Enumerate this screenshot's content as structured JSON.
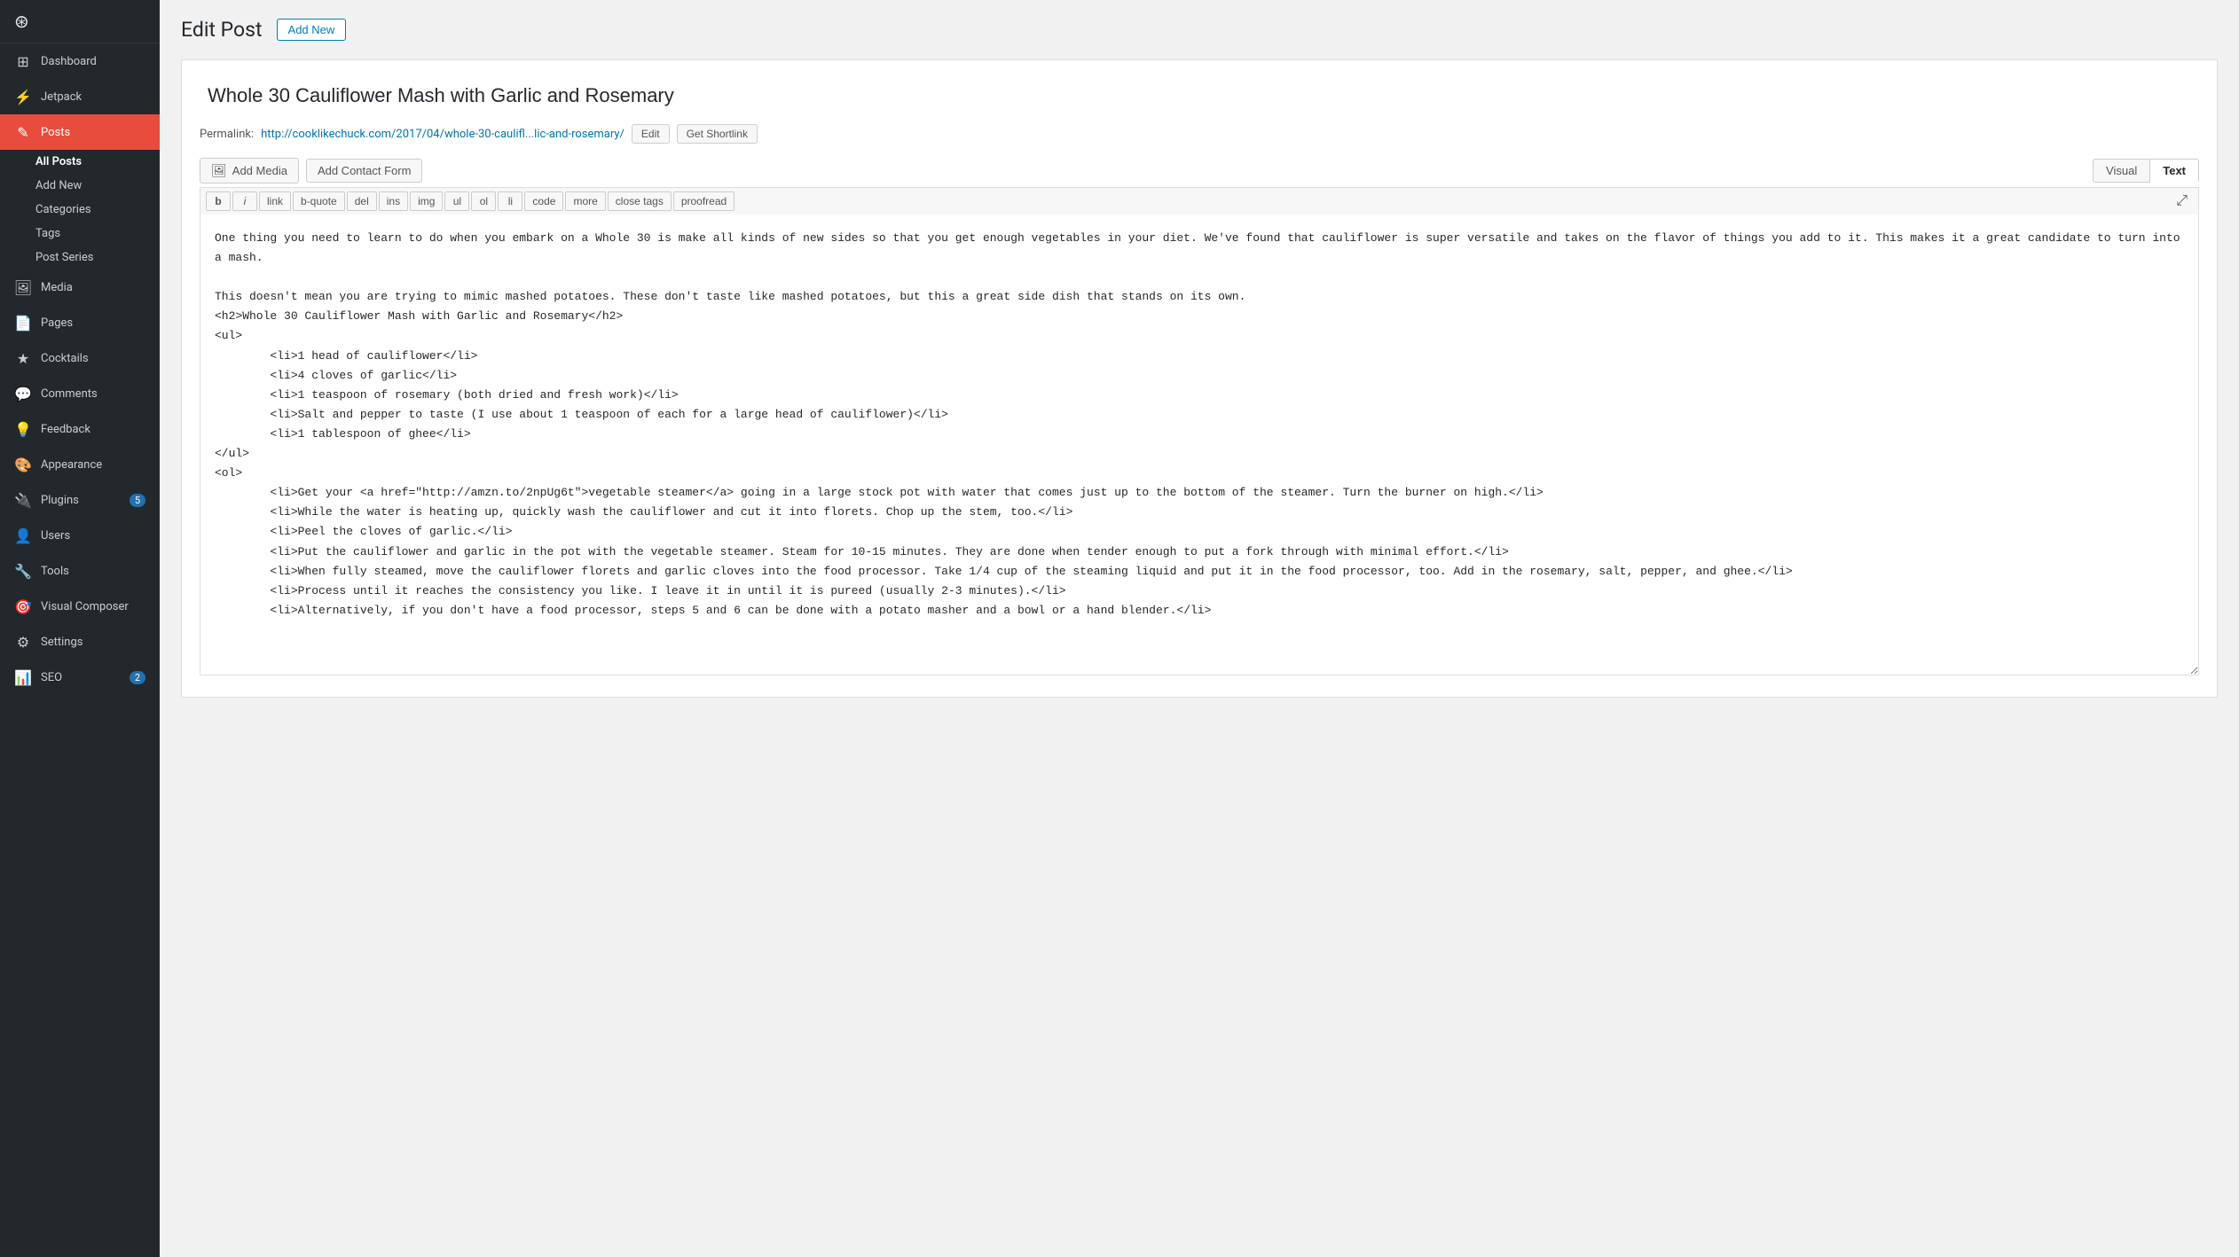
{
  "sidebar": {
    "items": [
      {
        "id": "dashboard",
        "label": "Dashboard",
        "icon": "⊞"
      },
      {
        "id": "jetpack",
        "label": "Jetpack",
        "icon": "⚡"
      },
      {
        "id": "posts",
        "label": "Posts",
        "icon": "📝",
        "active": true
      },
      {
        "id": "media",
        "label": "Media",
        "icon": "🖼"
      },
      {
        "id": "pages",
        "label": "Pages",
        "icon": "📄"
      },
      {
        "id": "cocktails",
        "label": "Cocktails",
        "icon": "★"
      },
      {
        "id": "comments",
        "label": "Comments",
        "icon": "💬"
      },
      {
        "id": "feedback",
        "label": "Feedback",
        "icon": "💡"
      },
      {
        "id": "appearance",
        "label": "Appearance",
        "icon": "🎨"
      },
      {
        "id": "plugins",
        "label": "Plugins",
        "icon": "🔌",
        "badge": "5"
      },
      {
        "id": "users",
        "label": "Users",
        "icon": "👤"
      },
      {
        "id": "tools",
        "label": "Tools",
        "icon": "🔧"
      },
      {
        "id": "visual-composer",
        "label": "Visual Composer",
        "icon": "🎯"
      },
      {
        "id": "settings",
        "label": "Settings",
        "icon": "⚙"
      },
      {
        "id": "seo",
        "label": "SEO",
        "icon": "📊",
        "badge": "2"
      }
    ],
    "subitems": [
      {
        "label": "All Posts",
        "active": true
      },
      {
        "label": "Add New"
      },
      {
        "label": "Categories"
      },
      {
        "label": "Tags"
      },
      {
        "label": "Post Series"
      }
    ]
  },
  "page": {
    "title": "Edit Post",
    "add_new_label": "Add New"
  },
  "post": {
    "title": "Whole 30 Cauliflower Mash with Garlic and Rosemary",
    "permalink_label": "Permalink:",
    "permalink_url": "http://cooklikechuck.com/2017/04/whole-30-caulifl...lic-and-rosemary/",
    "edit_btn": "Edit",
    "shortlink_btn": "Get Shortlink"
  },
  "toolbar": {
    "add_media": "Add Media",
    "add_contact_form": "Add Contact Form",
    "visual_tab": "Visual",
    "text_tab": "Text",
    "format_buttons": [
      "b",
      "i",
      "link",
      "b-quote",
      "del",
      "ins",
      "img",
      "ul",
      "ol",
      "li",
      "code",
      "more",
      "close tags",
      "proofread"
    ],
    "expand_icon": "⤢"
  },
  "editor": {
    "content": "One thing you need to learn to do when you embark on a Whole 30 is make all kinds of new sides so that you get enough vegetables in your diet. We've found that cauliflower is super versatile and takes on the flavor of things you add to it. This makes it a great candidate to turn into a mash.\n\nThis doesn't mean you are trying to mimic mashed potatoes. These don't taste like mashed potatoes, but this a great side dish that stands on its own.\n<h2>Whole 30 Cauliflower Mash with Garlic and Rosemary</h2>\n<ul>\n        <li>1 head of cauliflower</li>\n        <li>4 cloves of garlic</li>\n        <li>1 teaspoon of rosemary (both dried and fresh work)</li>\n        <li>Salt and pepper to taste (I use about 1 teaspoon of each for a large head of cauliflower)</li>\n        <li>1 tablespoon of ghee</li>\n</ul>\n<ol>\n        <li>Get your <a href=\"http://amzn.to/2npUg6t\">vegetable steamer</a> going in a large stock pot with water that comes just up to the bottom of the steamer. Turn the burner on high.</li>\n        <li>While the water is heating up, quickly wash the cauliflower and cut it into florets. Chop up the stem, too.</li>\n        <li>Peel the cloves of garlic.</li>\n        <li>Put the cauliflower and garlic in the pot with the vegetable steamer. Steam for 10-15 minutes. They are done when tender enough to put a fork through with minimal effort.</li>\n        <li>When fully steamed, move the cauliflower florets and garlic cloves into the food processor. Take 1/4 cup of the steaming liquid and put it in the food processor, too. Add in the rosemary, salt, pepper, and ghee.</li>\n        <li>Process until it reaches the consistency you like. I leave it in until it is pureed (usually 2-3 minutes).</li>\n        <li>Alternatively, if you don't have a food processor, steps 5 and 6 can be done with a potato masher and a bowl or a hand blender.</li>"
  }
}
